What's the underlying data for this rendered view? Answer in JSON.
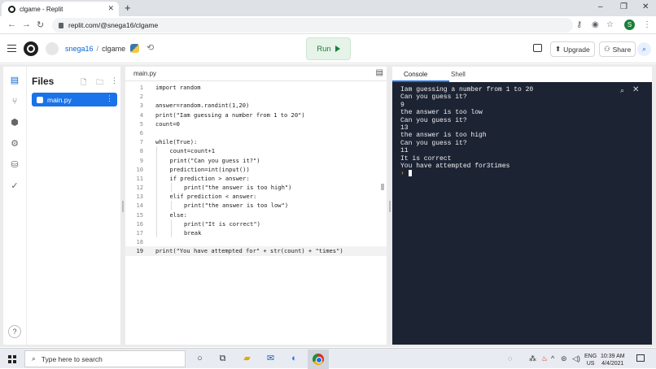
{
  "browser": {
    "tab_title": "clgame - Replit",
    "new_tab": "+",
    "url": "replit.com/@snega16/clgame",
    "profile_initial": "S",
    "window_controls": [
      "–",
      "❐",
      "✕"
    ]
  },
  "header": {
    "username": "snega16",
    "separator": "/",
    "repl_name": "clgame",
    "run_label": "Run",
    "upgrade_label": "Upgrade",
    "share_label": "Share"
  },
  "files": {
    "title": "Files",
    "items": [
      {
        "name": "main.py"
      }
    ]
  },
  "editor": {
    "tab_label": "main.py",
    "lines": [
      {
        "num": "1",
        "code": "import random",
        "indent": 0
      },
      {
        "num": "2",
        "code": "",
        "indent": 0
      },
      {
        "num": "3",
        "code": "answer=random.randint(1,20)",
        "indent": 0
      },
      {
        "num": "4",
        "code": "print(\"Iam guessing a number from 1 to 20\")",
        "indent": 0
      },
      {
        "num": "5",
        "code": "count=0",
        "indent": 0
      },
      {
        "num": "6",
        "code": "",
        "indent": 0
      },
      {
        "num": "7",
        "code": "while(True):",
        "indent": 0
      },
      {
        "num": "8",
        "code": "count=count+1",
        "indent": 1
      },
      {
        "num": "9",
        "code": "print(\"Can you guess it?\")",
        "indent": 1
      },
      {
        "num": "10",
        "code": "prediction=int(input())",
        "indent": 1
      },
      {
        "num": "11",
        "code": "if prediction > answer:",
        "indent": 1
      },
      {
        "num": "12",
        "code": "print(\"the answer is too high\")",
        "indent": 2
      },
      {
        "num": "13",
        "code": "elif prediction < answer:",
        "indent": 1
      },
      {
        "num": "14",
        "code": "print(\"the answer is too low\")",
        "indent": 2
      },
      {
        "num": "15",
        "code": "else:",
        "indent": 1
      },
      {
        "num": "16",
        "code": "print(\"It is correct\")",
        "indent": 2
      },
      {
        "num": "17",
        "code": "break",
        "indent": 2
      },
      {
        "num": "18",
        "code": "",
        "indent": 0
      },
      {
        "num": "19",
        "code": "print(\"You have attempted for\" + str(count) + \"times\")",
        "indent": 0
      }
    ]
  },
  "console": {
    "tabs": [
      "Console",
      "Shell"
    ],
    "output": [
      "Iam guessing a number from 1 to 20",
      "Can you guess it?",
      "9",
      "the answer is too low",
      "Can you guess it?",
      "13",
      "the answer is too high",
      "Can you guess it?",
      "11",
      "It is correct",
      "You have attempted for3times"
    ],
    "prompt": "›"
  },
  "taskbar": {
    "search_placeholder": "Type here to search",
    "lang_top": "ENG",
    "lang_bottom": "US",
    "time": "10:39 AM",
    "date": "4/4/2021"
  }
}
